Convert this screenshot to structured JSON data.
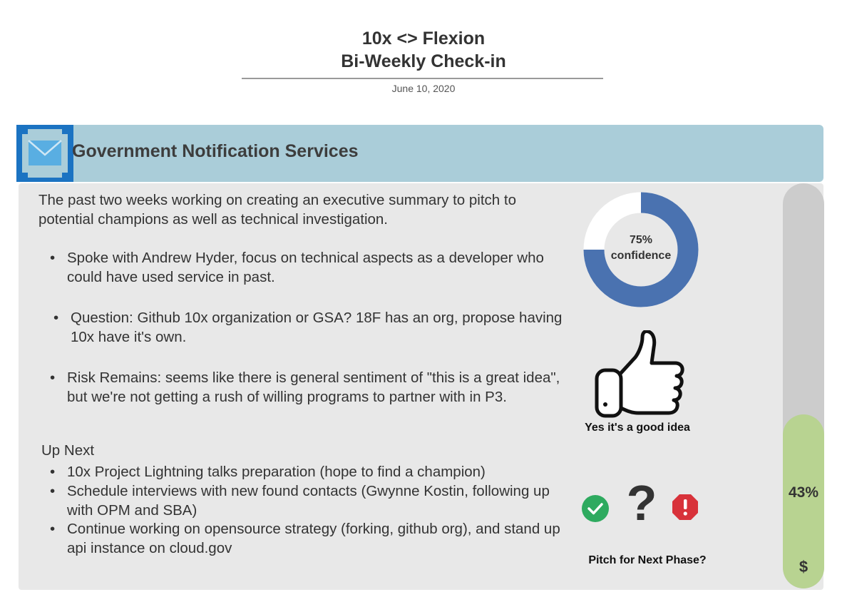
{
  "header": {
    "title_line1": "10x <> Flexion",
    "title_line2": "Bi-Weekly Check-in",
    "date": "June 10, 2020"
  },
  "section": {
    "title": "Government Notification Services",
    "icon": "mail-icon",
    "band_color": "#aacdd9"
  },
  "summary": {
    "intro": "The past two weeks working on creating an executive summary to pitch to potential champions as well as technical investigation.",
    "bullets": [
      "Spoke with Andrew Hyder, focus on technical aspects as a developer who could have used service in past.",
      "Question: Github 10x organization or GSA? 18F has an org, propose having 10x have it's own.",
      "Risk Remains: seems like there is general sentiment of \"this is a great idea\", but we're not getting a rush of willing programs to partner with in P3."
    ]
  },
  "up_next": {
    "heading": "Up Next",
    "items": [
      "10x Project Lightning talks preparation (hope to find a champion)",
      "Schedule interviews with new found contacts (Gwynne Kostin, following up with OPM and SBA)",
      "Continue working on opensource strategy (forking, github org), and stand up api instance on cloud.gov"
    ]
  },
  "confidence": {
    "value_label": "75%",
    "label": "confidence",
    "fraction": 0.75,
    "fill_color": "#4a72b0",
    "track_color": "#ffffff"
  },
  "idea": {
    "icon": "thumbs-up-icon",
    "label": "Yes it's a good idea"
  },
  "pitch": {
    "label": "Pitch for Next Phase?",
    "icons": [
      "check-circle-icon",
      "question-mark-icon",
      "stop-octagon-icon"
    ],
    "question_glyph": "?",
    "check_color": "#2eaa5f",
    "stop_color": "#d8323a"
  },
  "budget": {
    "percent_label": "43%",
    "fraction": 0.43,
    "unit": "$",
    "fill_color": "#b8d391",
    "track_color": "#cccccc"
  }
}
